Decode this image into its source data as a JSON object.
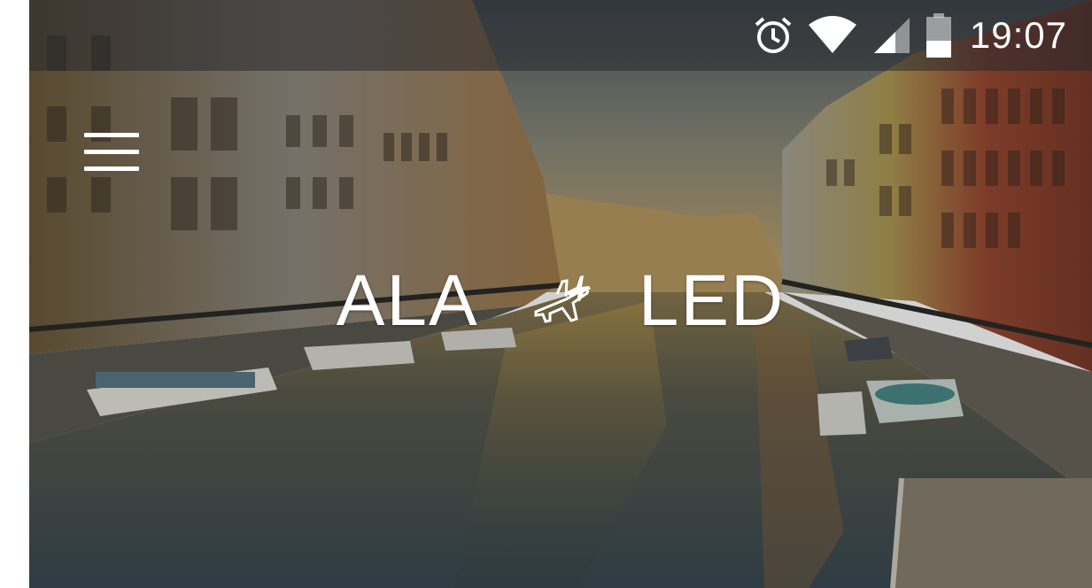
{
  "status_bar": {
    "time": "19:07",
    "icons": [
      "alarm-icon",
      "wifi-icon",
      "cellular-signal-icon",
      "battery-icon"
    ]
  },
  "header": {
    "menu_icon": "hamburger-menu-icon"
  },
  "route": {
    "origin": "ALA",
    "destination": "LED",
    "separator_icon": "airplane-icon"
  },
  "colors": {
    "text": "#ffffff",
    "status_bar_overlay": "#28282d"
  }
}
